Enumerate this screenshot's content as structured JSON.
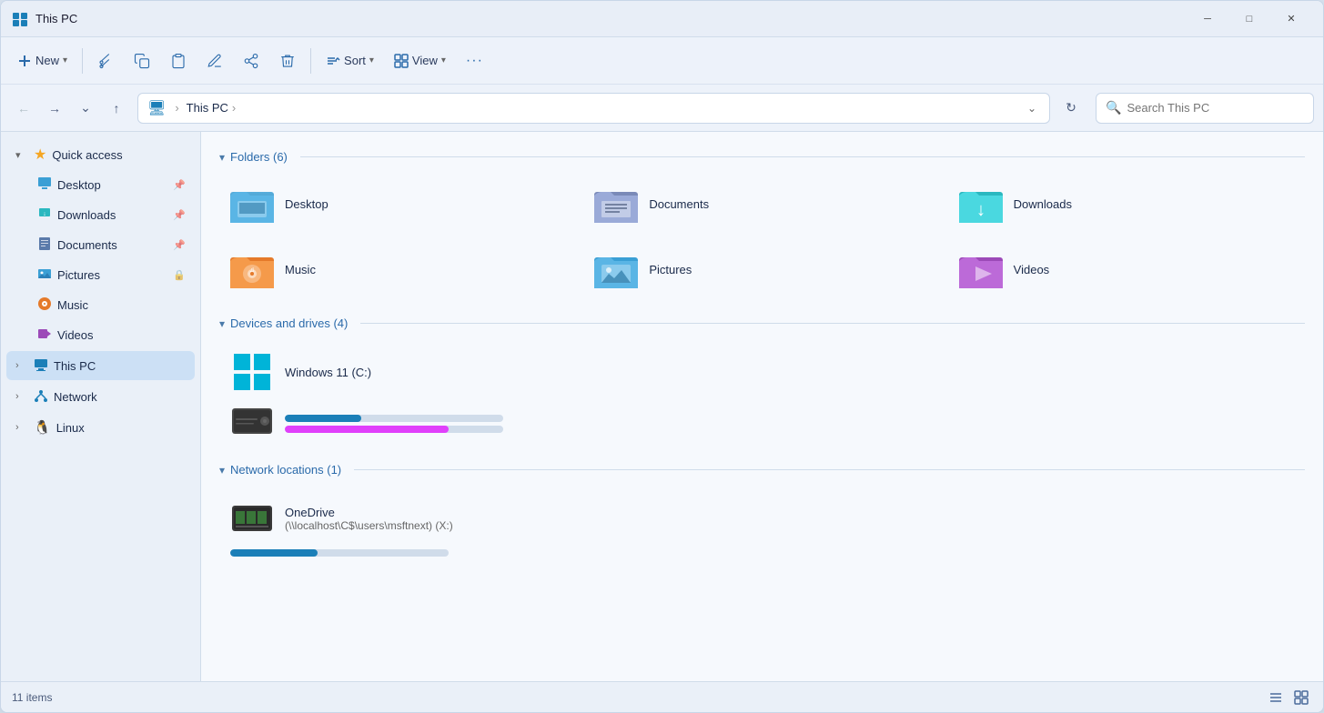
{
  "window": {
    "title": "This PC",
    "min_label": "─",
    "max_label": "□",
    "close_label": "✕"
  },
  "toolbar": {
    "new_label": "New",
    "sort_label": "Sort",
    "view_label": "View",
    "more_label": "···"
  },
  "addressbar": {
    "path_icon": "🖥",
    "path_text": "This PC",
    "separator": "›",
    "search_placeholder": "Search This PC"
  },
  "sidebar": {
    "quick_access": "Quick access",
    "desktop": "Desktop",
    "downloads": "Downloads",
    "documents": "Documents",
    "pictures": "Pictures",
    "music": "Music",
    "videos": "Videos",
    "this_pc": "This PC",
    "network": "Network",
    "linux": "Linux"
  },
  "content": {
    "folders_section": "Folders (6)",
    "devices_section": "Devices and drives (4)",
    "network_section": "Network locations (1)",
    "folders": [
      {
        "name": "Desktop",
        "color": "#3a9fd5"
      },
      {
        "name": "Documents",
        "color": "#5a7aaa"
      },
      {
        "name": "Downloads",
        "color": "#2ab8c0"
      },
      {
        "name": "Music",
        "color": "#e57a2a"
      },
      {
        "name": "Pictures",
        "color": "#3a9fd5"
      },
      {
        "name": "Videos",
        "color": "#9c4ab8"
      }
    ],
    "drives": [
      {
        "name": "Windows 11 (C:)",
        "progress_blue": 35,
        "progress_pink": 75
      }
    ],
    "network_locations": [
      {
        "name": "OneDrive",
        "sub": "(\\\\localhost\\C$\\users\\msftnext) (X:)",
        "progress": 40
      }
    ]
  },
  "statusbar": {
    "count": "11 items"
  }
}
